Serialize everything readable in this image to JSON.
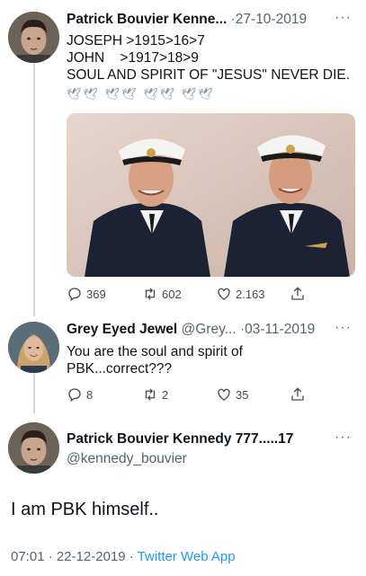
{
  "tweets": [
    {
      "author": "Patrick Bouvier Kenne...",
      "date": "·27-10-2019",
      "more": "···",
      "lines": [
        "JOSEPH >1915>16>7",
        "JOHN    >1917>18>9",
        "SOUL AND SPIRIT OF \"JESUS\" NEVER DIE."
      ],
      "doves": "🕊🕊 🕊🕊 🕊🕊 🕊🕊",
      "replies": "369",
      "retweets": "602",
      "likes": "2.163"
    },
    {
      "author": "Grey Eyed Jewel",
      "handle": "@Grey...",
      "date": "·03-11-2019",
      "more": "···",
      "lines": [
        "You are the soul and spirit of",
        "PBK...correct???"
      ],
      "replies": "8",
      "retweets": "2",
      "likes": "35"
    }
  ],
  "main": {
    "author": "Patrick Bouvier Kennedy 777.....17",
    "handle": "@kennedy_bouvier",
    "more": "···",
    "text": "I am PBK himself..",
    "time_date": "07:01 · 22-12-2019 · ",
    "app": "Twitter Web App"
  },
  "colors": {
    "link": "#1d9bf0",
    "secondary_text": "#536471",
    "thread_line": "#cfd9de"
  },
  "icons": [
    "reply-icon",
    "retweet-icon",
    "like-icon",
    "share-icon",
    "more-icon",
    "dove-emoji"
  ]
}
